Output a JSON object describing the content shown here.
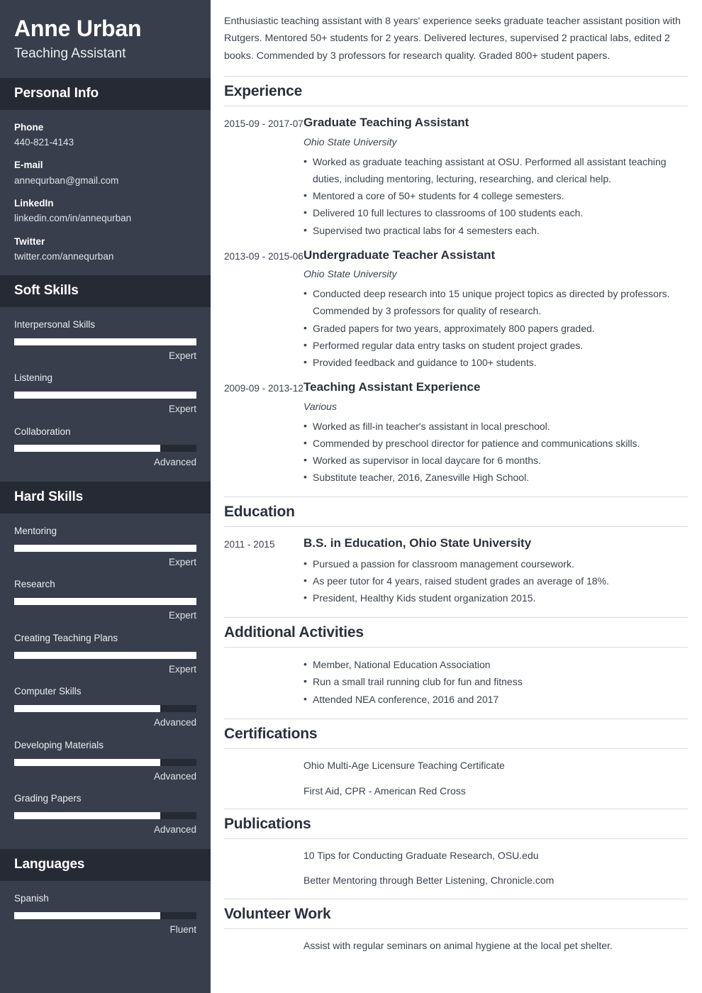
{
  "theme": {
    "sidebar_bg": "#383e4c",
    "sidebar_head_bg": "#252a35",
    "accent_text": "#ffffff",
    "main_text": "#3c434e",
    "heading_text": "#2b303b",
    "rule": "#d8dadd"
  },
  "sidebar": {
    "name": "Anne Urban",
    "job_title": "Teaching Assistant",
    "personal_info": {
      "heading": "Personal Info",
      "items": [
        {
          "label": "Phone",
          "value": "440-821-4143"
        },
        {
          "label": "E-mail",
          "value": "annequrban@gmail.com"
        },
        {
          "label": "LinkedIn",
          "value": "linkedin.com/in/annequrban"
        },
        {
          "label": "Twitter",
          "value": "twitter.com/annequrban"
        }
      ]
    },
    "soft_skills": {
      "heading": "Soft Skills",
      "items": [
        {
          "name": "Interpersonal Skills",
          "level": "Expert",
          "percent": 100
        },
        {
          "name": "Listening",
          "level": "Expert",
          "percent": 100
        },
        {
          "name": "Collaboration",
          "level": "Advanced",
          "percent": 80
        }
      ]
    },
    "hard_skills": {
      "heading": "Hard Skills",
      "items": [
        {
          "name": "Mentoring",
          "level": "Expert",
          "percent": 100
        },
        {
          "name": "Research",
          "level": "Expert",
          "percent": 100
        },
        {
          "name": "Creating Teaching Plans",
          "level": "Expert",
          "percent": 100
        },
        {
          "name": "Computer Skills",
          "level": "Advanced",
          "percent": 80
        },
        {
          "name": "Developing Materials",
          "level": "Advanced",
          "percent": 80
        },
        {
          "name": "Grading Papers",
          "level": "Advanced",
          "percent": 80
        }
      ]
    },
    "languages": {
      "heading": "Languages",
      "items": [
        {
          "name": "Spanish",
          "level": "Fluent",
          "percent": 80
        }
      ]
    }
  },
  "main": {
    "summary": "Enthusiastic teaching assistant with 8 years' experience seeks graduate teacher assistant position with Rutgers. Mentored 50+ students for 2 years. Delivered lectures, supervised 2 practical labs, edited 2 books. Commended by 3 professors for research quality. Graded 800+ student papers.",
    "experience": {
      "heading": "Experience",
      "entries": [
        {
          "date": "2015-09 - 2017-07",
          "title": "Graduate Teaching Assistant",
          "org": "Ohio State University",
          "bullets": [
            "Worked as graduate teaching assistant at OSU. Performed all assistant teaching duties, including mentoring, lecturing, researching, and clerical help.",
            "Mentored a core of 50+ students for 4 college semesters.",
            "Delivered 10 full lectures to classrooms of 100 students each.",
            "Supervised two practical labs for 4 semesters each."
          ]
        },
        {
          "date": "2013-09 - 2015-06",
          "title": "Undergraduate Teacher Assistant",
          "org": "Ohio State University",
          "bullets": [
            "Conducted deep research into 15 unique project topics as directed by professors. Commended by 3 professors for quality of research.",
            "Graded papers for two years, approximately 800 papers graded.",
            "Performed regular data entry tasks on student project grades.",
            "Provided feedback and guidance to 100+ students."
          ]
        },
        {
          "date": "2009-09 - 2013-12",
          "title": "Teaching Assistant Experience",
          "org": "Various",
          "bullets": [
            "Worked as fill-in teacher's assistant in local preschool.",
            "Commended by preschool director for patience and communications skills.",
            "Worked as supervisor in local daycare for 6 months.",
            "Substitute teacher, 2016, Zanesville High School."
          ]
        }
      ]
    },
    "education": {
      "heading": "Education",
      "entries": [
        {
          "date": "2011 - 2015",
          "title": "B.S. in Education, Ohio State University",
          "bullets": [
            "Pursued a passion for classroom management coursework.",
            "As peer tutor for 4 years, raised student grades an average of 18%.",
            "President, Healthy Kids student organization 2015."
          ]
        }
      ]
    },
    "additional_activities": {
      "heading": "Additional Activities",
      "bullets": [
        "Member, National Education Association",
        "Run a small trail running club for fun and fitness",
        "Attended NEA conference, 2016 and 2017"
      ]
    },
    "certifications": {
      "heading": "Certifications",
      "lines": [
        "Ohio Multi-Age Licensure Teaching Certificate",
        "First Aid, CPR - American Red Cross"
      ]
    },
    "publications": {
      "heading": "Publications",
      "lines": [
        "10 Tips for Conducting Graduate Research, OSU.edu",
        "Better Mentoring through Better Listening, Chronicle.com"
      ]
    },
    "volunteer_work": {
      "heading": "Volunteer Work",
      "lines": [
        "Assist with regular seminars on animal hygiene at the local pet shelter."
      ]
    }
  }
}
